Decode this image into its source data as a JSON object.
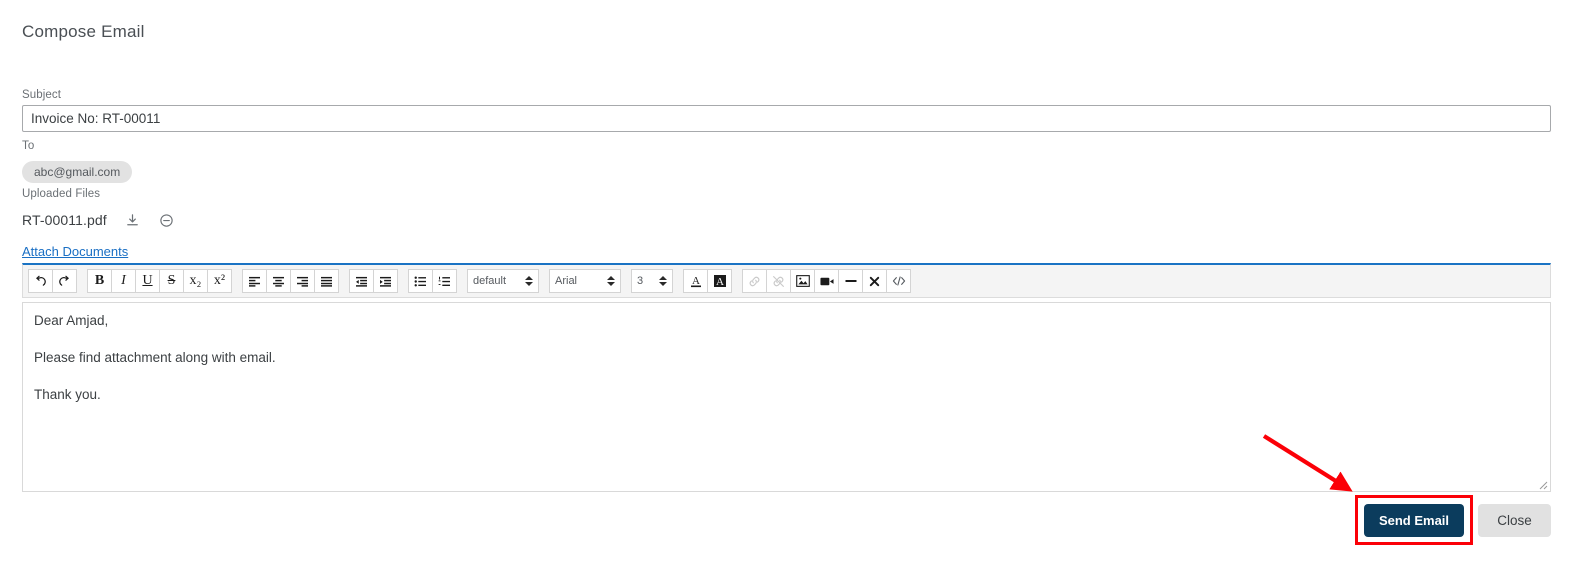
{
  "header": {
    "title": "Compose Email"
  },
  "form": {
    "subject": {
      "label": "Subject",
      "value": "Invoice No: RT-00011",
      "placeholder": "Subject"
    },
    "to": {
      "label": "To",
      "recipients": [
        "abc@gmail.com"
      ]
    },
    "uploaded_files": {
      "label": "Uploaded Files",
      "items": [
        {
          "name": "RT-00011.pdf",
          "download_icon": "download-icon",
          "remove_icon": "minus-circle-icon"
        }
      ]
    },
    "attach_link": "Attach Documents"
  },
  "editor": {
    "toolbar": {
      "groups": [
        {
          "buttons": [
            {
              "name": "undo-icon",
              "label": "↺",
              "disabled": false
            },
            {
              "name": "redo-icon",
              "label": "↻",
              "disabled": false
            }
          ]
        },
        {
          "buttons": [
            {
              "name": "bold-icon",
              "label": "B",
              "disabled": false
            },
            {
              "name": "italic-icon",
              "label": "I",
              "disabled": false
            },
            {
              "name": "underline-icon",
              "label": "U",
              "disabled": false
            },
            {
              "name": "strikethrough-icon",
              "label": "S",
              "disabled": false
            },
            {
              "name": "subscript-icon",
              "label": "x₂",
              "disabled": false
            },
            {
              "name": "superscript-icon",
              "label": "x²",
              "disabled": false
            }
          ]
        },
        {
          "buttons": [
            {
              "name": "align-left-icon",
              "label": "",
              "disabled": false
            },
            {
              "name": "align-center-icon",
              "label": "",
              "disabled": false
            },
            {
              "name": "align-right-icon",
              "label": "",
              "disabled": false
            },
            {
              "name": "align-justify-icon",
              "label": "",
              "disabled": false
            }
          ]
        },
        {
          "buttons": [
            {
              "name": "outdent-icon",
              "label": "",
              "disabled": false
            },
            {
              "name": "indent-icon",
              "label": "",
              "disabled": false
            }
          ]
        },
        {
          "buttons": [
            {
              "name": "unordered-list-icon",
              "label": "",
              "disabled": false
            },
            {
              "name": "ordered-list-icon",
              "label": "",
              "disabled": false
            }
          ]
        },
        {
          "buttons": [
            {
              "name": "text-color-icon",
              "label": "A",
              "disabled": false
            },
            {
              "name": "highlight-color-icon",
              "label": "A",
              "disabled": false
            }
          ]
        },
        {
          "buttons": [
            {
              "name": "link-icon",
              "label": "",
              "disabled": true
            },
            {
              "name": "unlink-icon",
              "label": "",
              "disabled": true
            },
            {
              "name": "image-icon",
              "label": "",
              "disabled": false
            },
            {
              "name": "video-icon",
              "label": "",
              "disabled": false
            },
            {
              "name": "horizontal-rule-icon",
              "label": "—",
              "disabled": false
            },
            {
              "name": "clear-format-icon",
              "label": "✖",
              "disabled": false
            },
            {
              "name": "code-view-icon",
              "label": "</>",
              "disabled": false
            }
          ]
        }
      ],
      "selects": [
        {
          "name": "paragraph-style-select",
          "value": "default"
        },
        {
          "name": "font-family-select",
          "value": "Arial"
        },
        {
          "name": "font-size-select",
          "value": "3"
        }
      ]
    },
    "body": {
      "paragraphs": [
        "Dear Amjad,",
        "Please find attachment along with email.",
        "Thank you."
      ]
    }
  },
  "footer": {
    "send_label": "Send Email",
    "close_label": "Close"
  },
  "annotation": {
    "highlight_color": "#fb0007",
    "target": "send-email-button"
  },
  "colors": {
    "primary_navy": "#0b3c5d",
    "toolbar_accent_blue": "#1a73c4",
    "link_blue": "#1a6fc4",
    "chip_grey": "#e2e2e2",
    "close_grey": "#e1e1e1"
  }
}
